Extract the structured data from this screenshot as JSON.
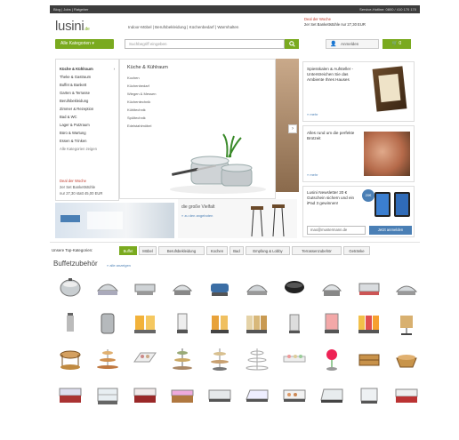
{
  "topbar": {
    "left": "Blog | Jobs | Ratgeber",
    "right": "Service-Hotline: 0800 / 410 170 170"
  },
  "logo": {
    "name": "lusini",
    "tld": ".de"
  },
  "topnav": "Indoor-Möbel | Berufsbekleidung | Küchenbedarf | Warmhalten",
  "deal": {
    "title": "Deal der Woche",
    "text": "2er Set Bankettstühle nur 27,30 EUR"
  },
  "category_button": "Alle Kategorien",
  "search": {
    "placeholder": "Suchbegriff eingeben"
  },
  "login": {
    "label": "Anmelden"
  },
  "cart": {
    "count": "0"
  },
  "menu": {
    "items": [
      "Küche & Kühlraum",
      "Theke & Gastraum",
      "Buffet & Bankett",
      "Garten & Terrasse",
      "Berufsbekleidung",
      "Zimmer & Rezeption",
      "Bad & WC",
      "Lager & Putzraum",
      "Büro & Wartung",
      "Essen & Trinken",
      "Alle Kategorien zeigen"
    ],
    "deal_title": "Deal der Woche",
    "deal_line1": "2er Set Bankettstühle",
    "deal_line2": "nur 27,30 statt 45,00 EUR"
  },
  "submenu": {
    "title": "Küche & Kühlraum",
    "items": [
      "Kochen",
      "Küchenbedarf",
      "Wiegen & Messen",
      "Küchentechnik",
      "Kühltechnik",
      "Spültechnik",
      "Edelstahlmöbel"
    ]
  },
  "promos": {
    "p1": {
      "text": "Spiesskalen & Aufsteller - Unterstreichen Sie das Ambiente Ihres Hauses",
      "more": "» mehr"
    },
    "p2": {
      "text": "Alles rund um die perfekte Brotzeit",
      "more": "» mehr"
    },
    "p3": {
      "text": "Lusini Newsletter 20 € Gutschein sichern und ein iPad 3 gewinnen!",
      "email": "max@mustermann.de",
      "button": "Jetzt anmelden",
      "badge": "20€"
    }
  },
  "midrow": {
    "vielfalt": "die große Vielfalt",
    "angebote": "» zu den angeboten"
  },
  "tabs": {
    "label": "Unsere Top-Kategorien:",
    "items": [
      "Buffet",
      "Möbel",
      "Berufsbekleidung",
      "Kochen",
      "Bad",
      "Empfang & Lobby",
      "Terrassenzubehör",
      "Getränke"
    ]
  },
  "section": {
    "title": "Buffetzubehör",
    "link": "» alle anzeigen"
  },
  "colors": {
    "accent": "#7aaa1f",
    "topbar": "#3d3d3d",
    "deal": "#c0392b",
    "link": "#4a7fb5"
  }
}
